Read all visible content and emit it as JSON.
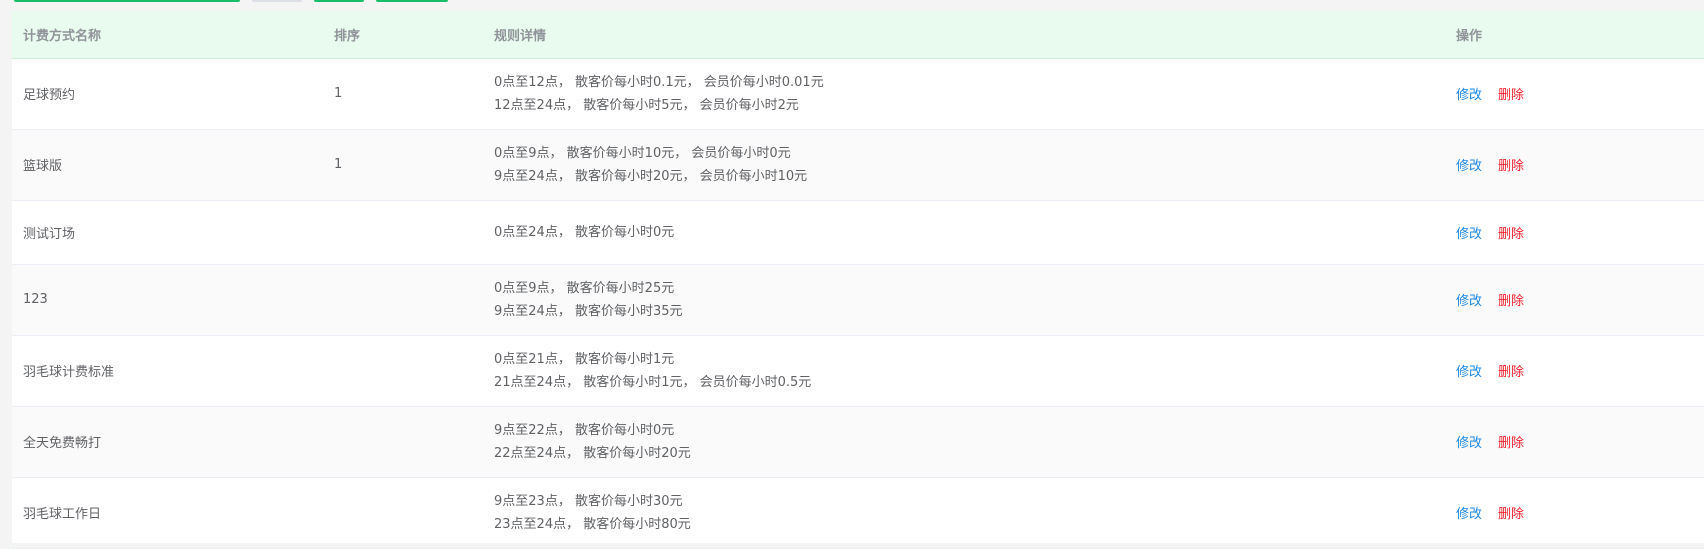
{
  "toolbar": {
    "accent_green": "#19be6b",
    "gray": "#dcdfe6"
  },
  "table": {
    "columns": [
      "计费方式名称",
      "排序",
      "规则详情",
      "操作"
    ],
    "rows": [
      {
        "name": "足球预约",
        "order": "1",
        "rules": [
          "0点至12点， 散客价每小时0.1元， 会员价每小时0.01元",
          "12点至24点， 散客价每小时5元， 会员价每小时2元"
        ]
      },
      {
        "name": "篮球版",
        "order": "1",
        "rules": [
          "0点至9点， 散客价每小时10元， 会员价每小时0元",
          "9点至24点， 散客价每小时20元， 会员价每小时10元"
        ]
      },
      {
        "name": "测试订场",
        "order": "",
        "rules": [
          "0点至24点， 散客价每小时0元",
          ""
        ]
      },
      {
        "name": "123",
        "order": "",
        "rules": [
          "0点至9点， 散客价每小时25元",
          "9点至24点， 散客价每小时35元"
        ]
      },
      {
        "name": "羽毛球计费标准",
        "order": "",
        "rules": [
          "0点至21点， 散客价每小时1元",
          "21点至24点， 散客价每小时1元， 会员价每小时0.5元"
        ]
      },
      {
        "name": "全天免费畅打",
        "order": "",
        "rules": [
          "9点至22点， 散客价每小时0元",
          "22点至24点， 散客价每小时20元"
        ]
      },
      {
        "name": "羽毛球工作日",
        "order": "",
        "rules": [
          "9点至23点， 散客价每小时30元",
          "23点至24点， 散客价每小时80元"
        ]
      }
    ],
    "actions": {
      "edit": "修改",
      "delete": "删除"
    }
  }
}
